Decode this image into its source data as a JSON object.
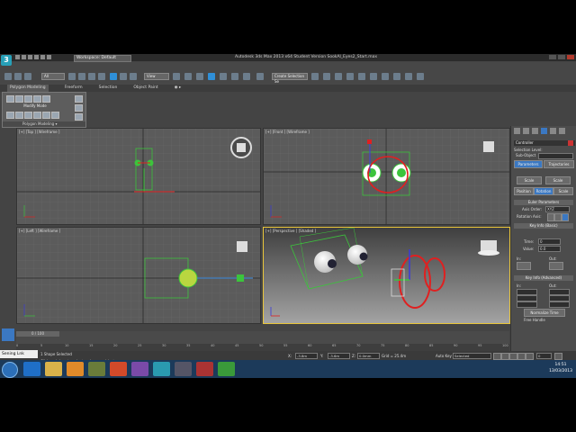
{
  "window": {
    "title": "Autodesk 3ds Max 2013 x64    Student Version   SookAl_Eyes2_Start.max",
    "workspace": "Workspace: Default",
    "logo_text": "3"
  },
  "toolbar": {
    "selection_filter": "All",
    "view_dropdown": "View",
    "named_selection": "Create Selection Se"
  },
  "ribbon": {
    "tabs": [
      "Polygon Modeling",
      "Freeform",
      "Selection",
      "Object Paint",
      "◉ ▸"
    ]
  },
  "polygon_panel": {
    "mode_label": "Modify Mode",
    "title": "Polygon Modeling ▾"
  },
  "viewports": {
    "top": "[+] [Top ] [Wireframe ]",
    "front": "[+] [Front ] [Wireframe ]",
    "left": "[+] [Left ] [Wireframe ]",
    "perspective": "[+] [Perspective ] [Shaded ]"
  },
  "command_panel": {
    "object_name": "Controller",
    "selection_level": "Selection Level:",
    "sub_object": "Sub-Object",
    "parameters_btn": "Parameters",
    "trajectories_btn": "Trajectories",
    "scale_btn": "Scale",
    "scale_btn2": "Scale",
    "position_btn": "Position",
    "rotation_btn": "Rotation",
    "scale_btn3": "Scale",
    "euler_roll": "Euler Parameters",
    "axis_order_label": "Axis Order:",
    "axis_order": "XYZ",
    "rotation_axis_label": "Rotation Axis:",
    "keyinfo_basic": "Key Info (Basic)",
    "time_label": "Time:",
    "value_label": "Value:",
    "time_value": "0",
    "value_value": "0.0",
    "in_label": "In:",
    "out_label": "Out:",
    "keyinfo_adv": "Key Info (Advanced)",
    "in2": "In:",
    "out2": "Out:",
    "norm_time": "Normalize Time",
    "free_handle": "Free Handle"
  },
  "timeline": {
    "slider": "0 / 100",
    "ticks": [
      "0",
      "5",
      "10",
      "15",
      "20",
      "25",
      "30",
      "35",
      "40",
      "45",
      "50",
      "55",
      "60",
      "65",
      "70",
      "75",
      "80",
      "85",
      "90",
      "95",
      "100"
    ]
  },
  "status": {
    "selected": "1 Shape Selected",
    "hint": "Click and drag to select and move objects",
    "miniscript": "Sening Lnk",
    "x_label": "X:",
    "x_val": "-3.8m",
    "y_label": "Y:",
    "y_val": "-3.6m",
    "z_label": "Z:",
    "z_val": "0.0mm",
    "grid": "Grid = 25.4m",
    "autokey": "Auto Key",
    "setkey": "Set Key",
    "selected_dd": "Selected",
    "key_filters": "Key Filters...",
    "add_time_tag": "Add Time Tag",
    "frame": "0"
  },
  "taskbar": {
    "time": "14:51",
    "date": "13/03/2013"
  },
  "colors": {
    "accent_blue": "#3b78c2",
    "active_viewport": "#e8c53a",
    "green_wire": "#3cc43c",
    "red_wire": "#e02020"
  }
}
